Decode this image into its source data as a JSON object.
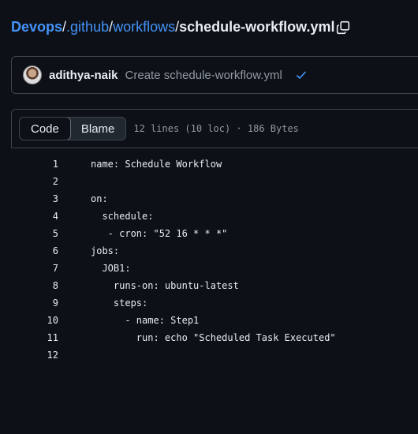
{
  "breadcrumb": {
    "root": "Devops",
    "sep1": "/",
    "dir1": ".github",
    "sep2": "/",
    "dir2": "workflows",
    "sep3": "/",
    "file": "schedule-workflow.yml"
  },
  "commit": {
    "author": "adithya-naik",
    "message": "Create schedule-workflow.yml",
    "status_icon": "check-icon",
    "status_color": "#4493f8"
  },
  "file_header": {
    "tabs": [
      {
        "label": "Code",
        "active": true
      },
      {
        "label": "Blame",
        "active": false
      }
    ],
    "meta": "12 lines (10 loc) · 186 Bytes"
  },
  "code_lines": [
    {
      "num": "1",
      "text": "name: Schedule Workflow"
    },
    {
      "num": "2",
      "text": ""
    },
    {
      "num": "3",
      "text": "on:"
    },
    {
      "num": "4",
      "text": "  schedule:"
    },
    {
      "num": "5",
      "text": "   - cron: \"52 16 * * *\""
    },
    {
      "num": "6",
      "text": "jobs:"
    },
    {
      "num": "7",
      "text": "  JOB1:"
    },
    {
      "num": "8",
      "text": "    runs-on: ubuntu-latest"
    },
    {
      "num": "9",
      "text": "    steps:"
    },
    {
      "num": "10",
      "text": "      - name: Step1"
    },
    {
      "num": "11",
      "text": "        run: echo \"Scheduled Task Executed\""
    },
    {
      "num": "12",
      "text": ""
    }
  ]
}
